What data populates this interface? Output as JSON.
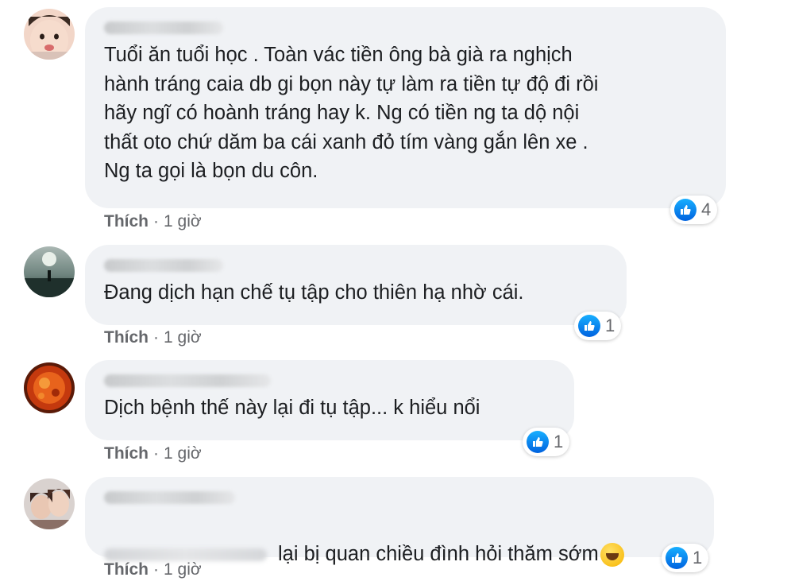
{
  "comments": [
    {
      "text": "Tuổi ăn tuổi học . Toàn vác tiền ông bà già ra nghịch\nhành tráng caia db gi bọn này tự làm ra tiền tự độ đi rồi\nhãy ngĩ có hoành tráng hay k. Ng có tiền ng ta dộ nội\nthất oto chứ dăm ba cái xanh đỏ tím vàng gắn lên xe .\nNg ta gọi là bọn du côn.",
      "like_label": "Thích",
      "time": "1 giờ",
      "reaction_count": "4"
    },
    {
      "text": "Đang dịch hạn chế tụ tập cho thiên hạ nhờ cái.",
      "like_label": "Thích",
      "time": "1 giờ",
      "reaction_count": "1"
    },
    {
      "text": "Dịch bệnh thế này lại đi tụ tập... k hiểu nổi",
      "like_label": "Thích",
      "time": "1 giờ",
      "reaction_count": "1"
    },
    {
      "text": "lại bị quan chiều đình hỏi thăm sớm",
      "like_label": "Thích",
      "time": "1 giờ",
      "reaction_count": "1",
      "emoji": "laughing-emoji"
    }
  ],
  "separator": "·",
  "colors": {
    "bubble": "#f0f2f5",
    "meta_text": "#65676b",
    "like_blue": "#1877f2"
  },
  "icons": {
    "reaction": "like-thumbs-up-icon"
  }
}
